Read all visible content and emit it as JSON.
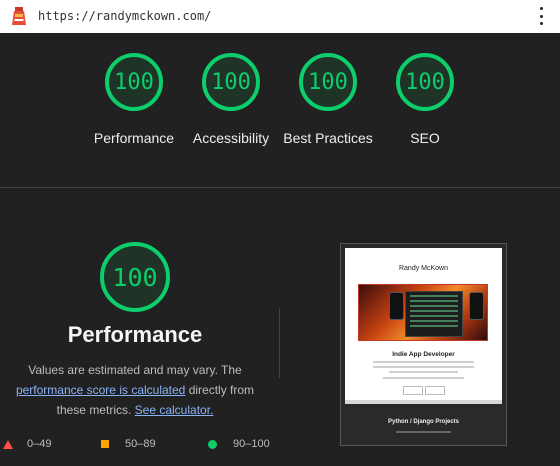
{
  "browser": {
    "url": "https://randymckown.com/"
  },
  "categories": [
    {
      "score": "100",
      "label": "Performance"
    },
    {
      "score": "100",
      "label": "Accessibility"
    },
    {
      "score": "100",
      "label": "Best Practices"
    },
    {
      "score": "100",
      "label": "SEO"
    }
  ],
  "performance": {
    "score": "100",
    "title": "Performance",
    "desc_before": "Values are estimated and may vary. The ",
    "link1": "performance score is calculated",
    "desc_middle": " directly from these metrics. ",
    "link2": "See calculator."
  },
  "legend": [
    {
      "range": "0–49",
      "color": "#ff4e42"
    },
    {
      "range": "50–89",
      "color": "#ffa400"
    },
    {
      "range": "90–100",
      "color": "#0cce6b"
    }
  ],
  "screenshot": {
    "name": "Randy McKown",
    "headline": "Indie App Developer",
    "projects": "Python / Django Projects"
  },
  "colors": {
    "pass": "#0cce6b",
    "background": "#212121"
  }
}
